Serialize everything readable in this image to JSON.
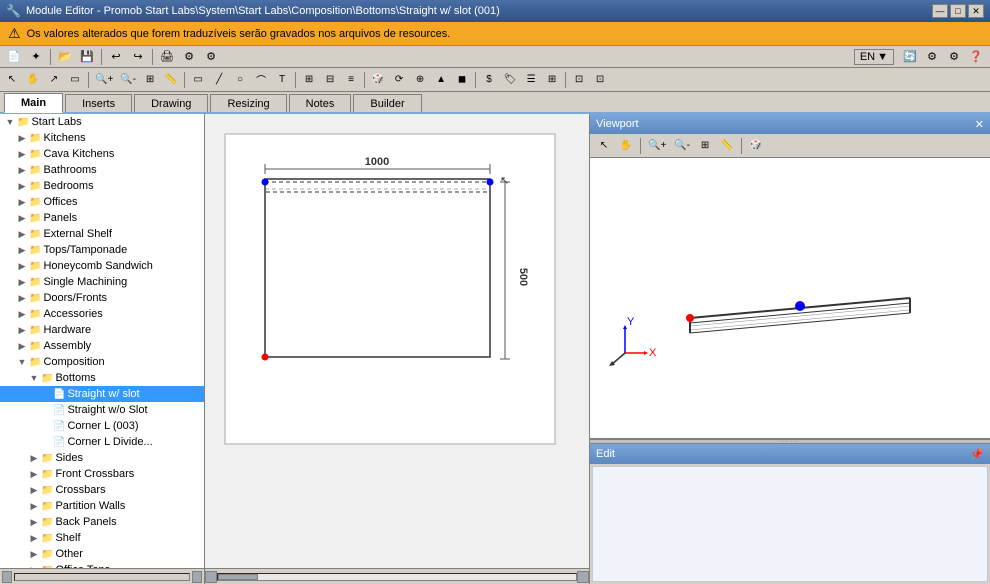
{
  "titleBar": {
    "icon": "🔧",
    "title": "Module Editor - Promob Start Labs\\System\\Start Labs\\Composition\\Bottoms\\Straight w/ slot (001)",
    "minBtn": "—",
    "maxBtn": "□",
    "closeBtn": "✕"
  },
  "warningBar": {
    "icon": "⚠",
    "text": "Os valores alterados que forem traduzíveis serão gravados nos arquivos de resources."
  },
  "languageBtn": "EN",
  "tabs": {
    "items": [
      {
        "label": "Main",
        "active": true
      },
      {
        "label": "Inserts",
        "active": false
      },
      {
        "label": "Drawing",
        "active": false
      },
      {
        "label": "Resizing",
        "active": false
      },
      {
        "label": "Notes",
        "active": false
      },
      {
        "label": "Builder",
        "active": false
      }
    ]
  },
  "tree": {
    "items": [
      {
        "label": "Start Labs",
        "indent": 1,
        "type": "root",
        "expanded": true
      },
      {
        "label": "Kitchens",
        "indent": 2,
        "type": "folder",
        "expanded": false
      },
      {
        "label": "Cava Kitchens",
        "indent": 2,
        "type": "folder",
        "expanded": false
      },
      {
        "label": "Bathrooms",
        "indent": 2,
        "type": "folder",
        "expanded": false
      },
      {
        "label": "Bedrooms",
        "indent": 2,
        "type": "folder",
        "expanded": false
      },
      {
        "label": "Offices",
        "indent": 2,
        "type": "folder",
        "expanded": false
      },
      {
        "label": "Panels",
        "indent": 2,
        "type": "folder",
        "expanded": false
      },
      {
        "label": "External Shelf",
        "indent": 2,
        "type": "folder",
        "expanded": false
      },
      {
        "label": "Tops/Tamponade",
        "indent": 2,
        "type": "folder",
        "expanded": false
      },
      {
        "label": "Honeycomb Sandwich",
        "indent": 2,
        "type": "folder",
        "expanded": false
      },
      {
        "label": "Single Machining",
        "indent": 2,
        "type": "folder",
        "expanded": false
      },
      {
        "label": "Doors/Fronts",
        "indent": 2,
        "type": "folder",
        "expanded": false
      },
      {
        "label": "Accessories",
        "indent": 2,
        "type": "folder",
        "expanded": false
      },
      {
        "label": "Hardware",
        "indent": 2,
        "type": "folder",
        "expanded": false
      },
      {
        "label": "Assembly",
        "indent": 2,
        "type": "folder",
        "expanded": false
      },
      {
        "label": "Composition",
        "indent": 2,
        "type": "folder",
        "expanded": true
      },
      {
        "label": "Bottoms",
        "indent": 3,
        "type": "folder",
        "expanded": true
      },
      {
        "label": "Straight w/ slot",
        "indent": 4,
        "type": "file",
        "expanded": false,
        "selected": true
      },
      {
        "label": "Straight w/o Slot",
        "indent": 4,
        "type": "file",
        "expanded": false
      },
      {
        "label": "Corner L (003)",
        "indent": 4,
        "type": "file",
        "expanded": false
      },
      {
        "label": "Corner L Divide...",
        "indent": 4,
        "type": "file",
        "expanded": false
      },
      {
        "label": "Sides",
        "indent": 3,
        "type": "folder",
        "expanded": false
      },
      {
        "label": "Front Crossbars",
        "indent": 3,
        "type": "folder",
        "expanded": false
      },
      {
        "label": "Crossbars",
        "indent": 3,
        "type": "folder",
        "expanded": false
      },
      {
        "label": "Partition Walls",
        "indent": 3,
        "type": "folder",
        "expanded": false
      },
      {
        "label": "Back Panels",
        "indent": 3,
        "type": "folder",
        "expanded": false
      },
      {
        "label": "Shelf",
        "indent": 3,
        "type": "folder",
        "expanded": false
      },
      {
        "label": "Other",
        "indent": 3,
        "type": "folder",
        "expanded": false
      },
      {
        "label": "Office Tops",
        "indent": 3,
        "type": "folder",
        "expanded": false
      }
    ]
  },
  "drawing": {
    "dimensionWidth": "1000",
    "dimensionHeight": "500"
  },
  "viewport": {
    "title": "Viewport",
    "closeBtn": "✕"
  },
  "edit": {
    "title": "Edit",
    "pinBtn": "📌"
  }
}
